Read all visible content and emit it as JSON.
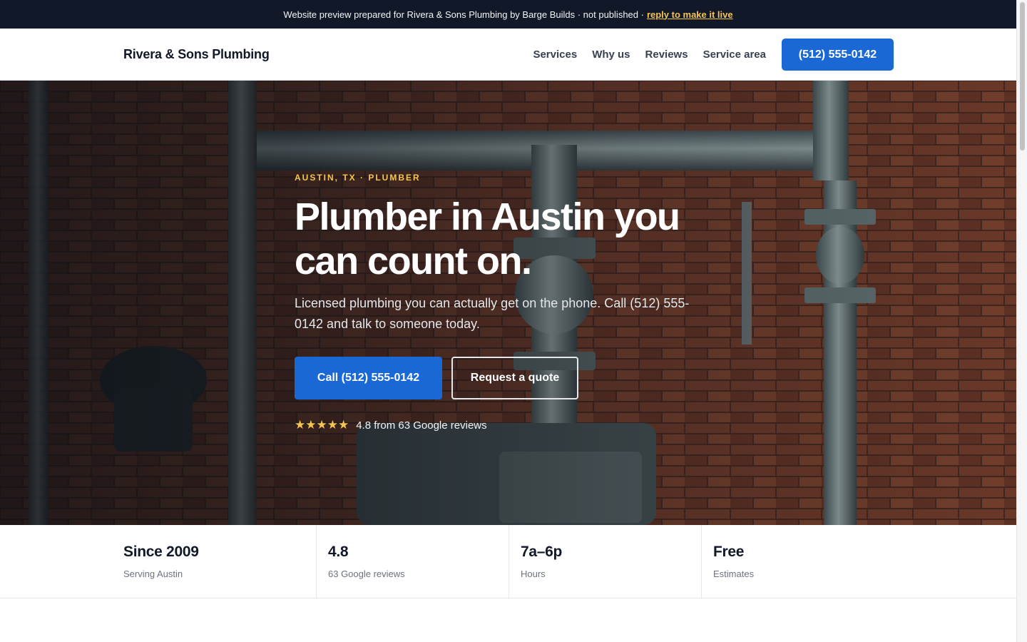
{
  "banner": {
    "text": "Website preview prepared for Rivera & Sons Plumbing by Barge Builds · not published ·",
    "link": "reply to make it live"
  },
  "header": {
    "brand": "Rivera & Sons Plumbing",
    "nav": [
      "Services",
      "Why us",
      "Reviews",
      "Service area"
    ],
    "phone_button": "(512) 555-0142"
  },
  "hero": {
    "eyebrow": "AUSTIN, TX · PLUMBER",
    "title": "Plumber in Austin you can count on.",
    "subtitle": "Licensed plumbing you can actually get on the phone. Call (512) 555-0142 and talk to someone today.",
    "primary_cta": "Call (512) 555-0142",
    "secondary_cta": "Request a quote",
    "stars": "★★★★★",
    "rating_text": "4.8 from 63 Google reviews"
  },
  "stats": [
    {
      "big": "Since 2009",
      "small": "Serving Austin"
    },
    {
      "big": "4.8",
      "small": "63 Google reviews"
    },
    {
      "big": "7a–6p",
      "small": "Hours"
    },
    {
      "big": "Free",
      "small": "Estimates"
    }
  ],
  "colors": {
    "accent_blue": "#1a68d6",
    "accent_gold": "#f5c451",
    "banner_bg": "#111827"
  }
}
